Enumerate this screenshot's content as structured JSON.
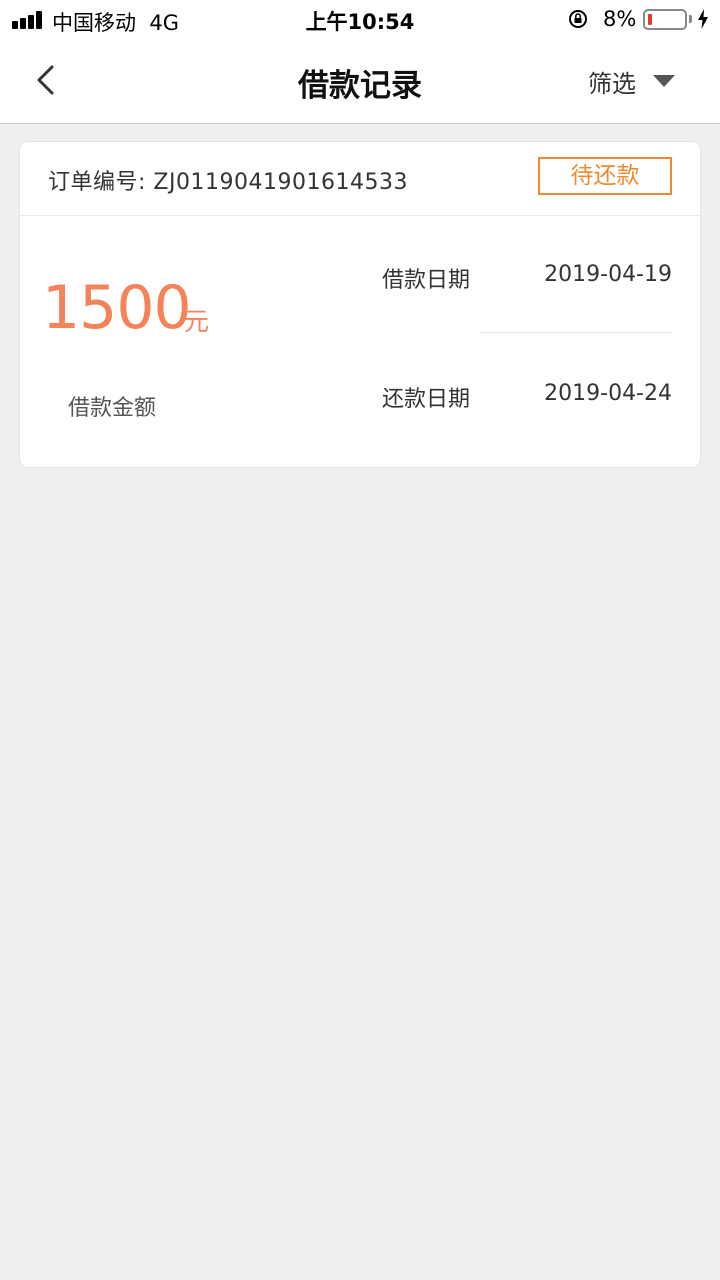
{
  "status_bar": {
    "carrier": "中国移动",
    "network": "4G",
    "time": "上午10:54",
    "battery_percent": "8%",
    "battery_level": 0.08
  },
  "nav": {
    "title": "借款记录",
    "filter_label": "筛选"
  },
  "record": {
    "order_label": "订单编号:",
    "order_number": "ZJ0119041901614533",
    "status": "待还款",
    "amount": "1500",
    "amount_unit": "元",
    "amount_label": "借款金额",
    "loan_date_label": "借款日期",
    "loan_date": "2019-04-19",
    "repay_date_label": "还款日期",
    "repay_date": "2019-04-24"
  },
  "colors": {
    "accent": "#f4835a",
    "badge": "#f08a30",
    "background": "#efefef"
  }
}
